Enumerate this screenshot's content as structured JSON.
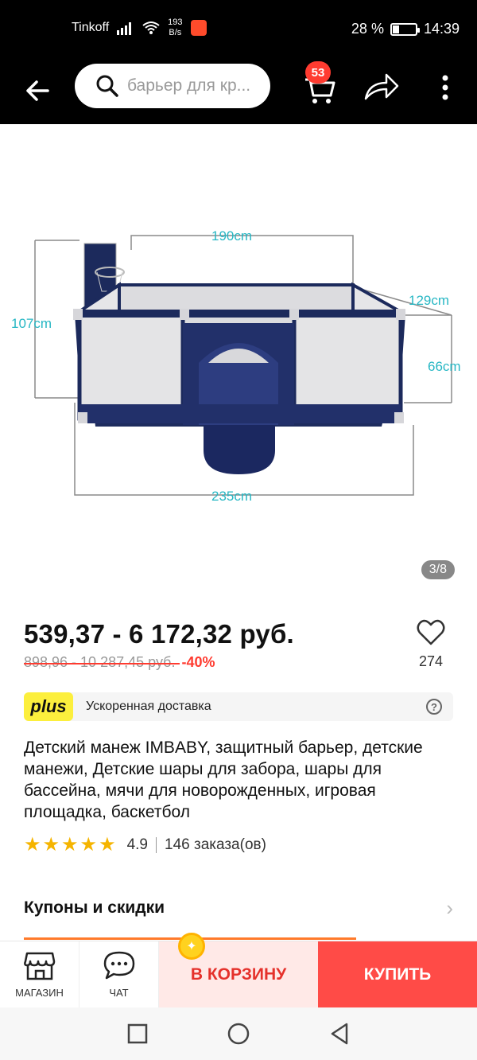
{
  "status_bar": {
    "carrier": "Tinkoff",
    "net_speed_value": "193",
    "net_speed_unit": "B/s",
    "battery": "28 %",
    "battery_level": 0.28,
    "time": "14:39"
  },
  "app_bar": {
    "search_placeholder": "барьер для кр...",
    "cart_count": "53"
  },
  "gallery": {
    "counter": "3/8",
    "dimensions": {
      "width_top": "190cm",
      "height_left": "107cm",
      "depth": "129cm",
      "height_right": "66cm",
      "width_bottom": "235cm"
    }
  },
  "product": {
    "price": "539,37 - 6 172,32 руб.",
    "old_price": "898,96 - 10 287,45 руб.",
    "discount": "-40%",
    "favorites": "274",
    "plus_badge": "plus",
    "plus_text": "Ускоренная доставка",
    "title": "Детский манеж IMBABY, защитный барьер, детские манежи, Детские шары для забора, шары для бассейна, мячи для новорожденных, игровая площадка, баскетбол",
    "rating": "4.9",
    "rating_value": 4.9,
    "orders": "146 заказа(ов)"
  },
  "coupons": {
    "label": "Купоны и скидки"
  },
  "bottom_bar": {
    "store": "МАГАЗИН",
    "chat": "ЧАТ",
    "add_to_cart": "В КОРЗИНУ",
    "buy": "КУПИТЬ"
  },
  "colors": {
    "accent_red": "#ff4b47",
    "plus_yellow": "#fcef3d",
    "star": "#f5b400",
    "dimension_text": "#27b7c4"
  }
}
